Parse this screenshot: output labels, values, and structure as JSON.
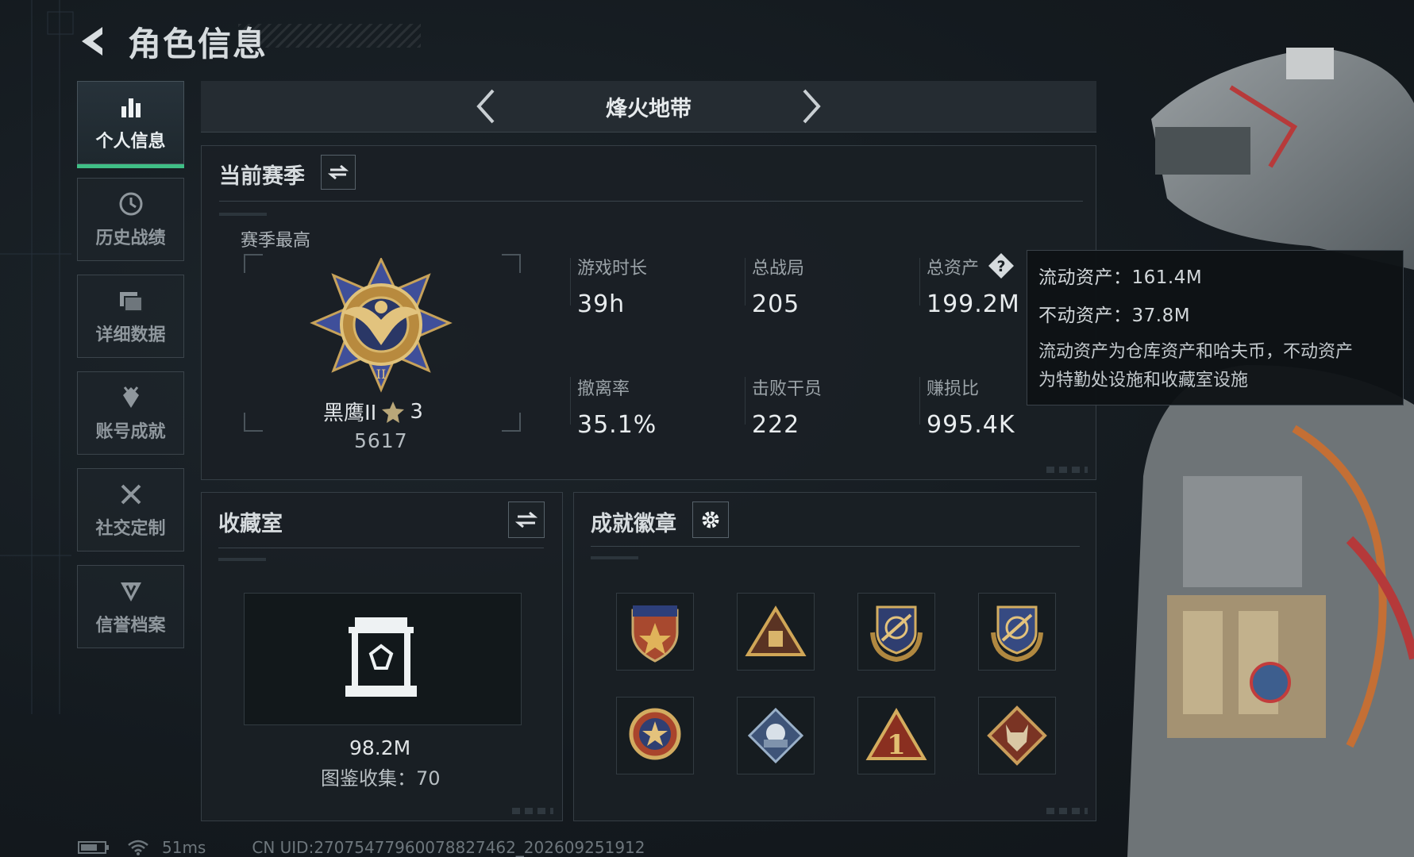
{
  "header": {
    "title": "角色信息"
  },
  "sidebar": {
    "items": [
      {
        "label": "个人信息",
        "icon": "bar-chart-icon",
        "active": true
      },
      {
        "label": "历史战绩",
        "icon": "history-clock-icon",
        "active": false
      },
      {
        "label": "详细数据",
        "icon": "folders-icon",
        "active": false
      },
      {
        "label": "账号成就",
        "icon": "achievement-icon",
        "active": false
      },
      {
        "label": "社交定制",
        "icon": "tools-icon",
        "active": false
      },
      {
        "label": "信誉档案",
        "icon": "credit-shield-icon",
        "active": false
      }
    ]
  },
  "mode": {
    "title": "烽火地带"
  },
  "season": {
    "title": "当前赛季",
    "best_label": "赛季最高",
    "rank_name": "黑鹰II",
    "rank_stars": "3",
    "rank_score": "5617",
    "stats": [
      {
        "label": "游戏时长",
        "value": "39h"
      },
      {
        "label": "总战局",
        "value": "205"
      },
      {
        "label": "总资产",
        "value": "199.2M"
      },
      {
        "label": "撤离率",
        "value": "35.1%"
      },
      {
        "label": "击败干员",
        "value": "222"
      },
      {
        "label": "赚损比",
        "value": "995.4K"
      }
    ]
  },
  "tooltip": {
    "liquid": "流动资产：161.4M",
    "fixed": "不动资产：37.8M",
    "desc_line1": "流动资产为仓库资产和哈夫币，不动资产",
    "desc_line2": "为特勤处设施和收藏室设施"
  },
  "collection": {
    "title": "收藏室",
    "value": "98.2M",
    "count": "图鉴收集：70"
  },
  "badges": {
    "title": "成就徽章",
    "items": [
      "shield-star-badge-icon",
      "pyramid-badge-icon",
      "crosshair-wreath-badge-icon",
      "crosshair-wreath-badge-icon",
      "star-medal-badge-icon",
      "diamond-tech-badge-icon",
      "number-one-badge-icon",
      "wolf-badge-icon"
    ]
  },
  "footer": {
    "ping": "51ms",
    "uid": "CN UID:27075477960078827462_202609251912"
  },
  "colors": {
    "accent_green": "#3fbf86",
    "panel": "#1a2025",
    "text": "#e8ecee"
  }
}
